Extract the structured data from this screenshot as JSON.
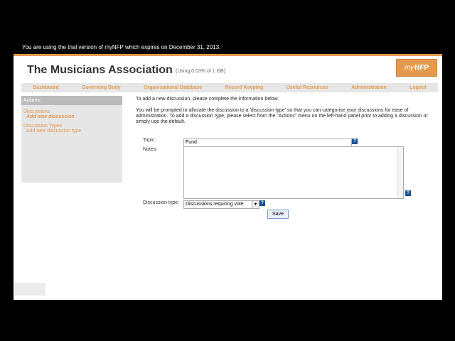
{
  "trial_banner": "You are using the trial version of myNFP which expires on December 31, 2013.",
  "header": {
    "org_name": "The Musicians Association",
    "usage": "(Using 0.03% of 1 GB)",
    "logo_my": "my",
    "logo_nfp": "NFP"
  },
  "nav": [
    "Dashboard",
    "Governing Body",
    "Organisational Database",
    "Record Keeping",
    "Useful Resources",
    "Administration",
    "Logout"
  ],
  "sidebar": {
    "header": "Actions:",
    "discussions": "Discussions",
    "add_discussion": "Add new discussion",
    "discussion_types": "Discussion Types",
    "add_discussion_type": "Add new discussion type"
  },
  "main": {
    "intro": "To add a new discussion, please complete the information below.",
    "instructions": "You will be prompted to allocate the discussion to a 'discussion type' so that you can categorise your discussions for ease of administration. To add a discussion type, please select from the \"Actions\" menu on the left-hand panel prior to adding a discussion or simply use the default.",
    "topic_label": "Topic:",
    "topic_value": "Fund",
    "notes_label": "Notes:",
    "type_label": "Discussion type:",
    "type_value": "Discussions requiring vote",
    "save_label": "Save",
    "help_glyph": "?"
  },
  "colors": {
    "accent": "#e39a4f",
    "help": "#1e4f8c"
  }
}
